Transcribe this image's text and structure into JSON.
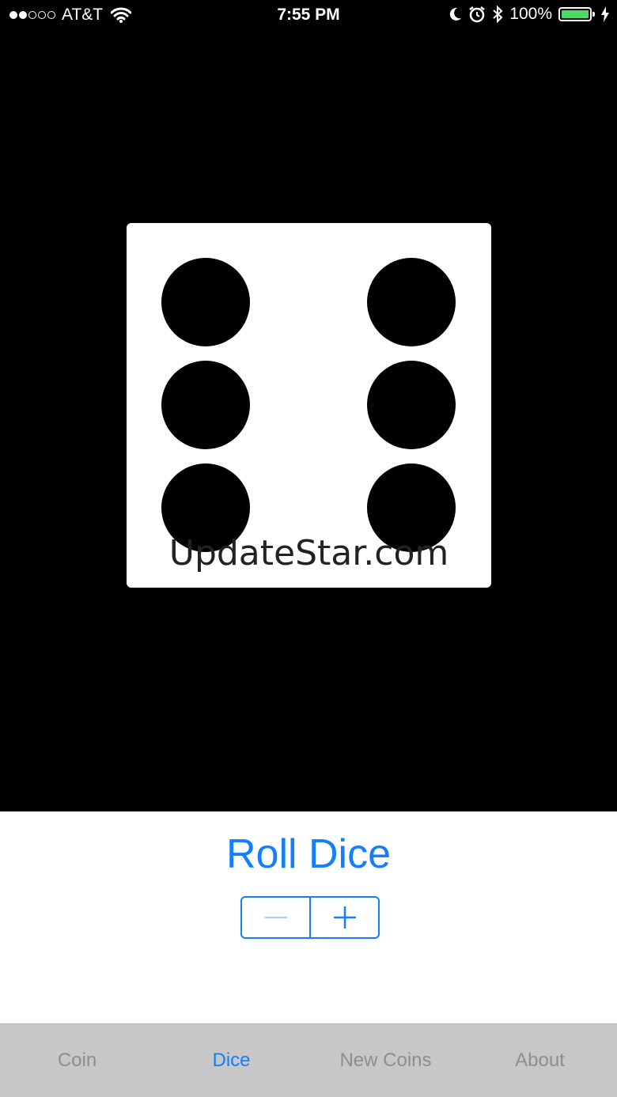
{
  "status_bar": {
    "carrier": "AT&T",
    "time": "7:55 PM",
    "battery": "100%",
    "signal_bars_filled": 2,
    "signal_bars_total": 5,
    "icons": [
      "wifi-icon",
      "moon-icon",
      "alarm-icon",
      "bluetooth-icon",
      "battery-icon",
      "charging-icon"
    ]
  },
  "dice": {
    "value": 6,
    "watermark": "UpdateStar.com"
  },
  "controls": {
    "roll_label": "Roll Dice",
    "stepper_minus_icon": "minus-icon",
    "stepper_plus_icon": "plus-icon"
  },
  "tabs": [
    {
      "label": "Coin",
      "active": false
    },
    {
      "label": "Dice",
      "active": true
    },
    {
      "label": "New Coins",
      "active": false
    },
    {
      "label": "About",
      "active": false
    }
  ],
  "colors": {
    "accent": "#147efb",
    "battery_fill": "#4cd964",
    "tab_bar_bg": "#c7c7c7",
    "tab_inactive": "#8e8e8e",
    "stepper_disabled": "#a9cff8"
  }
}
